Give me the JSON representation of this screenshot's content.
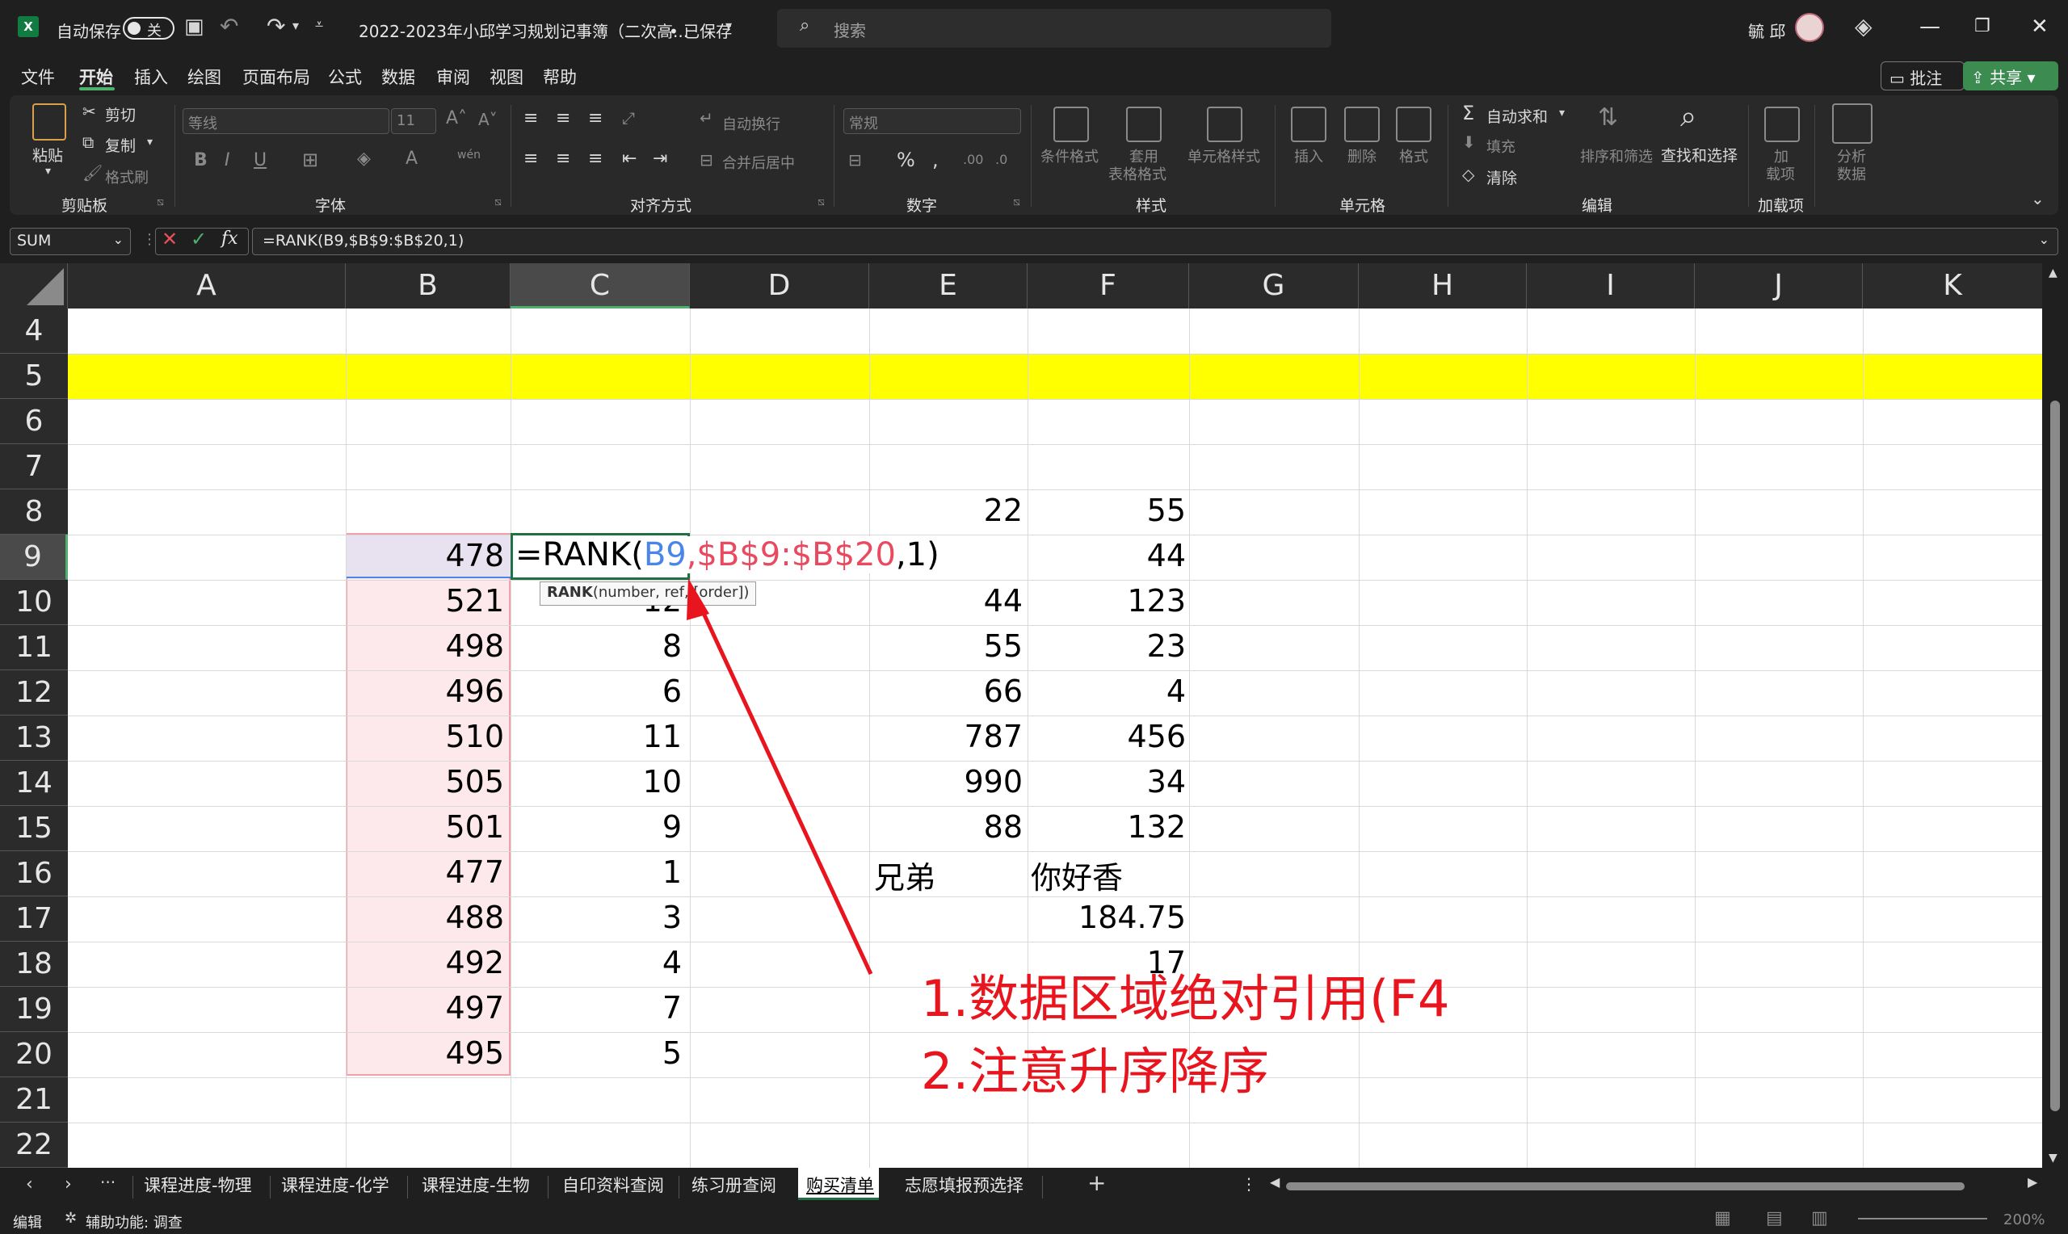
{
  "titlebar": {
    "autosave_label": "自动保存",
    "toggle_label": "关",
    "filename": "2022-2023年小邱学习规划记事簿（二次高...",
    "save_state": "• 已保存",
    "search_placeholder": "搜索",
    "user": "毓 邱"
  },
  "menu": {
    "tabs": [
      "文件",
      "开始",
      "插入",
      "绘图",
      "页面布局",
      "公式",
      "数据",
      "审阅",
      "视图",
      "帮助"
    ],
    "comment_label": "批注",
    "share_label": "共享"
  },
  "ribbon": {
    "paste": "粘贴",
    "cut": "剪切",
    "copy": "复制",
    "format_painter": "格式刷",
    "clipboard_group": "剪贴板",
    "font_name": "等线",
    "font_size": "11",
    "font_group": "字体",
    "wrap_text": "自动换行",
    "merge_center": "合并后居中",
    "align_group": "对齐方式",
    "number_format": "常规",
    "number_group": "数字",
    "cond_format": "条件格式",
    "table_format_1": "套用",
    "table_format_2": "表格格式",
    "cell_styles": "单元格样式",
    "styles_group": "样式",
    "insert": "插入",
    "delete": "删除",
    "format": "格式",
    "cells_group": "单元格",
    "autosum": "自动求和",
    "fill": "填充",
    "clear": "清除",
    "sort_filter": "排序和筛选",
    "find_select": "查找和选择",
    "edit_group": "编辑",
    "addins_1": "加",
    "addins_2": "载项",
    "addins_group": "加载项",
    "analyze_1": "分析",
    "analyze_2": "数据"
  },
  "formula_bar": {
    "name_box": "SUM",
    "fx": "fx",
    "formula": "=RANK(B9,$B$9:$B$20,1)"
  },
  "grid": {
    "columns": [
      "A",
      "B",
      "C",
      "D",
      "E",
      "F",
      "G",
      "H",
      "I",
      "J",
      "K"
    ],
    "rows": [
      "4",
      "5",
      "6",
      "7",
      "8",
      "9",
      "10",
      "11",
      "12",
      "13",
      "14",
      "15",
      "16",
      "17",
      "18",
      "19",
      "20",
      "21",
      "22"
    ],
    "col_b": [
      "478",
      "521",
      "498",
      "496",
      "510",
      "505",
      "501",
      "477",
      "488",
      "492",
      "497",
      "495"
    ],
    "col_c": [
      "12",
      "8",
      "6",
      "11",
      "10",
      "9",
      "1",
      "3",
      "4",
      "7",
      "5"
    ],
    "col_e": [
      "22",
      "",
      "44",
      "55",
      "66",
      "787",
      "990",
      "88"
    ],
    "col_f": [
      "55",
      "44",
      "123",
      "23",
      "4",
      "456",
      "34",
      "132"
    ],
    "e16": "兄弟",
    "f16": "你好香",
    "f17": "184.75",
    "f18": "17",
    "edit_formula": {
      "prefix": "=RANK(",
      "ref1": "B9",
      "comma1": ",",
      "ref2": "$B$9:$B$20",
      "suffix": ",1)"
    },
    "tooltip_fn": "RANK",
    "tooltip_args": "(number, ref, [order])",
    "highlight_color": "#ffff00",
    "ref1_color": "#4a86e8",
    "ref2_color": "#e84a5f"
  },
  "annotation": {
    "line1": "1.数据区域绝对引用(F4",
    "line2": "2.注意升序降序",
    "color": "#e8141e"
  },
  "sheets": {
    "tabs": [
      "课程进度-物理",
      "课程进度-化学",
      "课程进度-生物",
      "自印资料查阅",
      "练习册查阅",
      "购买清单",
      "志愿填报预选择"
    ],
    "active": "购买清单",
    "ellipsis": "···",
    "add": "+"
  },
  "status": {
    "mode": "编辑",
    "accessibility": "辅助功能: 调查",
    "zoom": "200%"
  }
}
